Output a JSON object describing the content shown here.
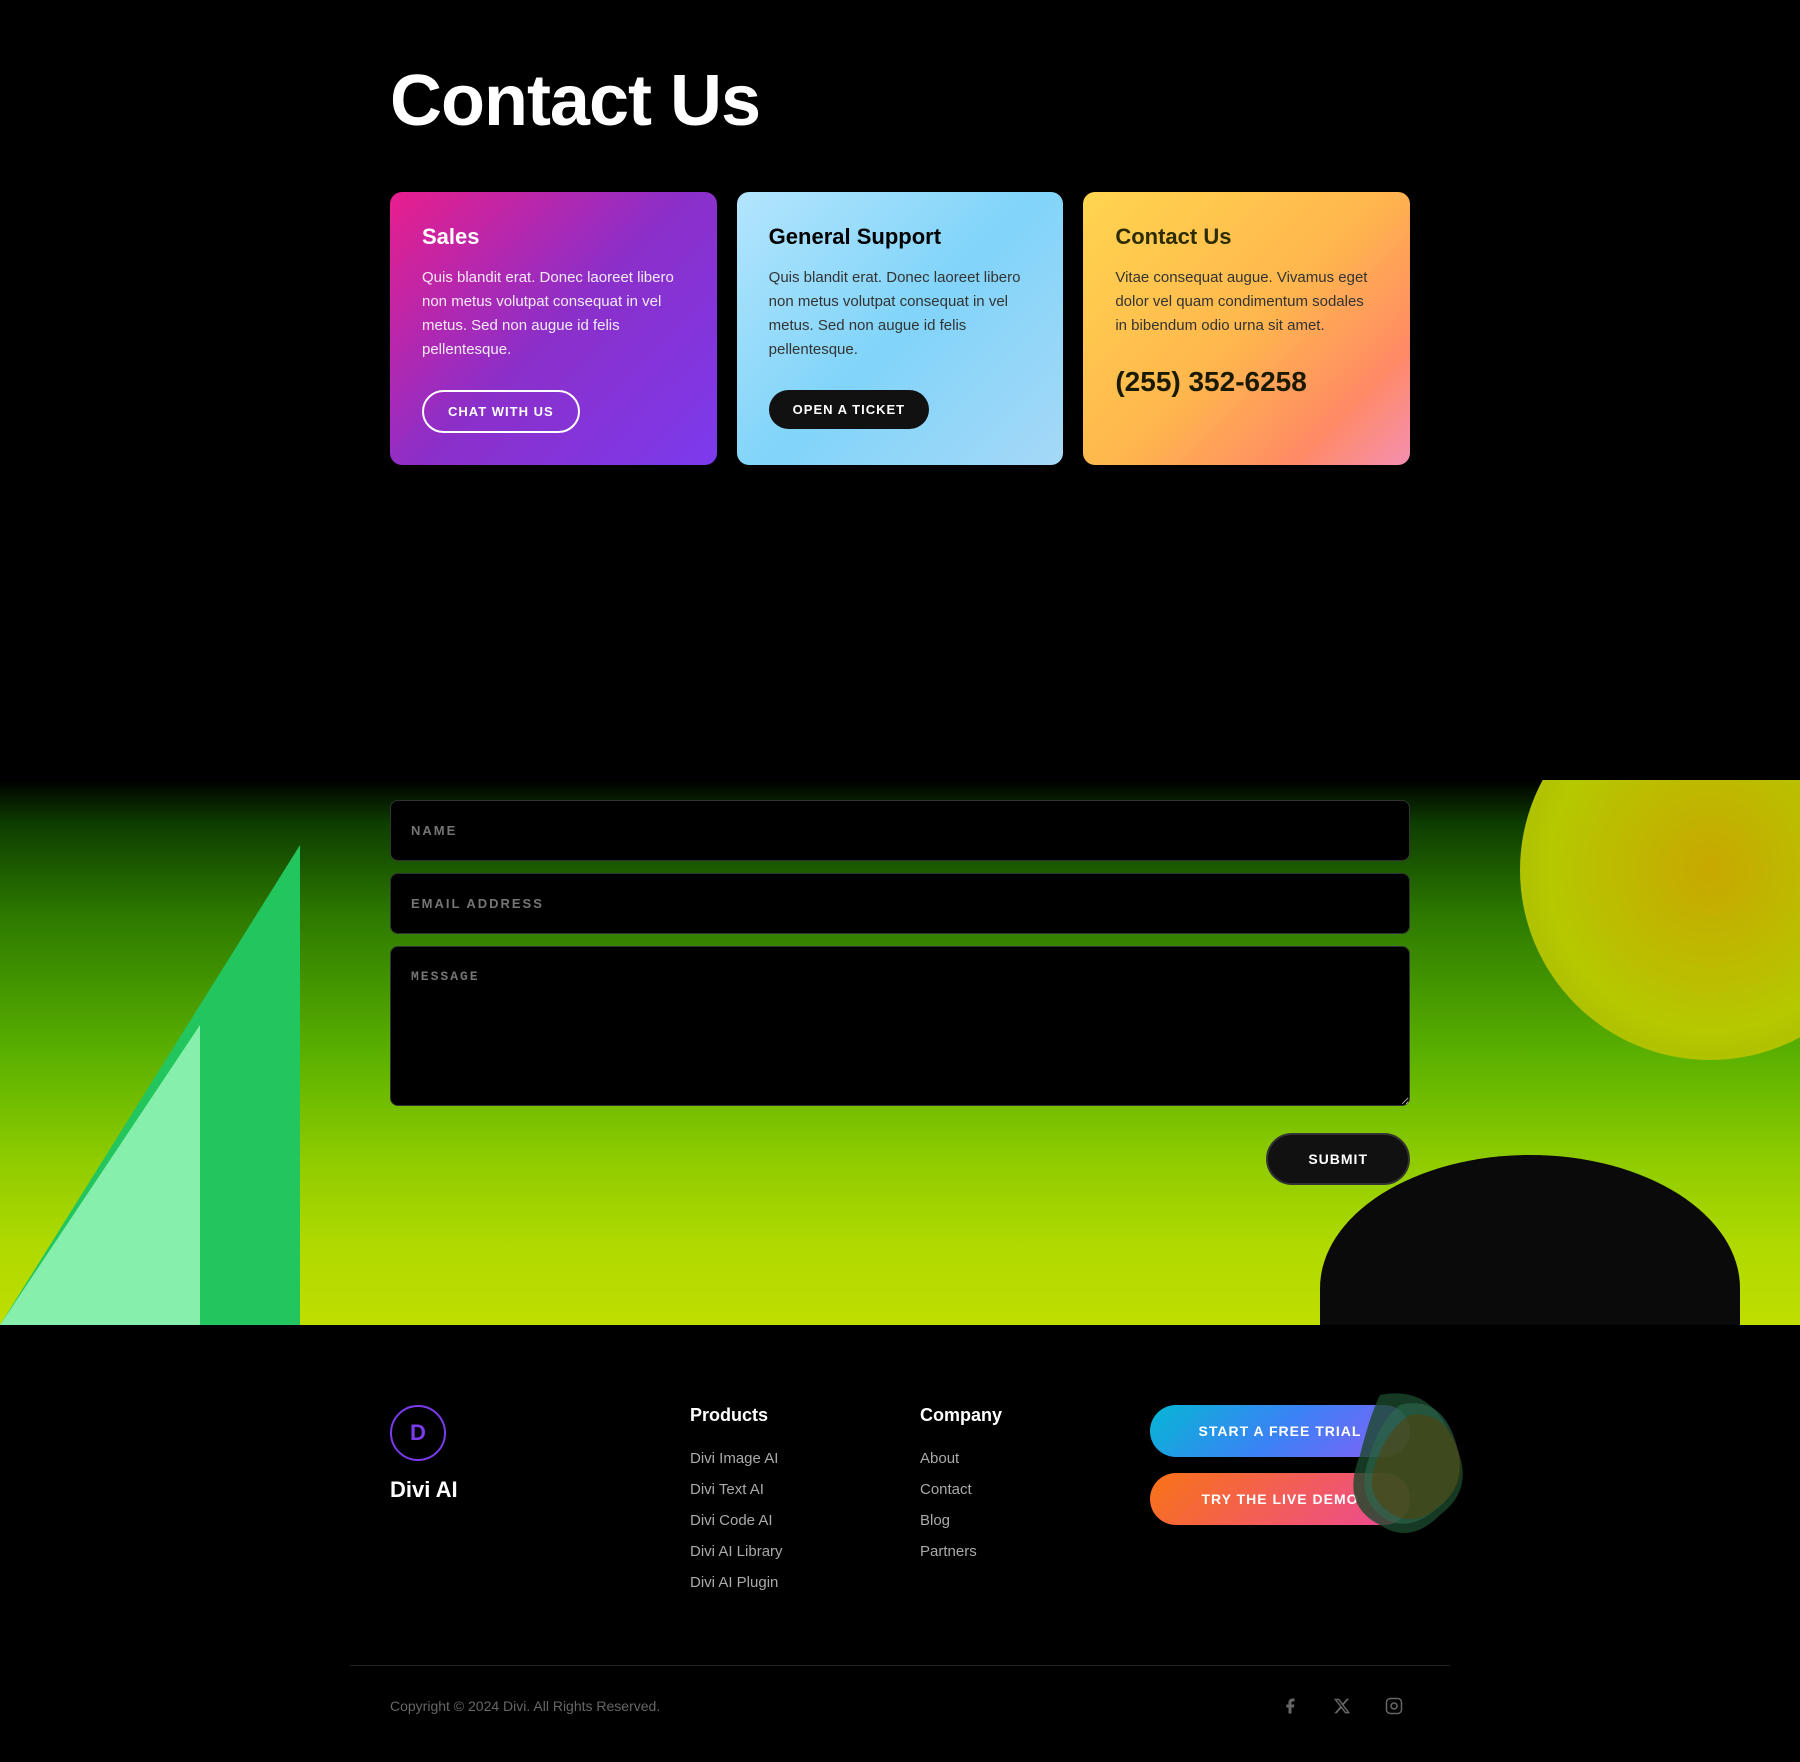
{
  "page": {
    "title": "Contact Us"
  },
  "cards": [
    {
      "id": "sales",
      "title": "Sales",
      "text": "Quis blandit erat. Donec laoreet libero non metus volutpat consequat in vel metus. Sed non augue id felis pellentesque.",
      "btn_label": "CHAT WITH US",
      "btn_type": "outline"
    },
    {
      "id": "support",
      "title": "General Support",
      "text": "Quis blandit erat. Donec laoreet libero non metus volutpat consequat in vel metus. Sed non augue id felis pellentesque.",
      "btn_label": "OPEN A TICKET",
      "btn_type": "dark"
    },
    {
      "id": "contact",
      "title": "Contact Us",
      "text": "Vitae consequat augue. Vivamus eget dolor vel quam condimentum sodales in bibendum odio urna sit amet.",
      "phone": "(255) 352-6258"
    }
  ],
  "form": {
    "name_placeholder": "NAME",
    "email_placeholder": "EMAIL ADDRESS",
    "message_placeholder": "MESSAGE",
    "submit_label": "SUBMIT"
  },
  "footer": {
    "logo_letter": "D",
    "brand_name": "Divi AI",
    "products_title": "Products",
    "products": [
      "Divi Image AI",
      "Divi Text AI",
      "Divi Code AI",
      "Divi AI Library",
      "Divi AI Plugin"
    ],
    "company_title": "Company",
    "company_links": [
      "About",
      "Contact",
      "Blog",
      "Partners"
    ],
    "cta_trial": "START A FREE TRIAL",
    "cta_demo": "TRY THE LIVE DEMO",
    "copyright": "Copyright © 2024 Divi. All Rights Reserved."
  }
}
